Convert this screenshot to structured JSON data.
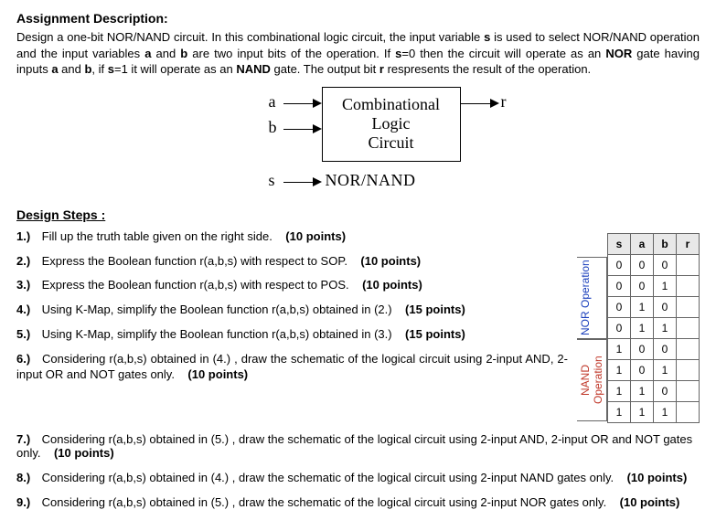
{
  "title": "Assignment Description:",
  "description_parts": {
    "p1": "Design a one-bit NOR/NAND circuit. In this combinational logic circuit, the input variable ",
    "s": "s",
    "p2": " is used to select NOR/NAND operation and the input variables ",
    "a": "a",
    "p3": " and ",
    "b": "b",
    "p4": " are two input bits of the operation. If ",
    "s0": "s",
    "p5": "=0 then the circuit will operate as an ",
    "nor": "NOR",
    "p6": " gate having inputs ",
    "a2": "a",
    "p7": " and ",
    "b2": "b",
    "p8": ", if ",
    "s1": "s",
    "p9": "=1 it will operate as an ",
    "nand": "NAND",
    "p10": " gate. The output bit ",
    "r": "r",
    "p11": " respresents the result of the operation."
  },
  "diagram": {
    "a": "a",
    "b": "b",
    "s": "s",
    "r": "r",
    "box_l1": "Combinational",
    "box_l2": "Logic",
    "box_l3": "Circuit",
    "nor_nand": "NOR/NAND"
  },
  "design_steps_title": "Design Steps :",
  "steps": [
    {
      "n": "1.)",
      "t": "Fill up the truth table given on the right side.",
      "p": "(10 points)"
    },
    {
      "n": "2.)",
      "t": "Express the Boolean function r(a,b,s) with respect to SOP.",
      "p": "(10 points)"
    },
    {
      "n": "3.)",
      "t": "Express the Boolean function r(a,b,s) with respect to POS.",
      "p": "(10 points)"
    },
    {
      "n": "4.)",
      "t": "Using K-Map, simplify the Boolean function r(a,b,s) obtained in (2.)",
      "p": "(15 points)"
    },
    {
      "n": "5.)",
      "t": "Using K-Map, simplify the Boolean function r(a,b,s) obtained in (3.)",
      "p": "(15 points)"
    },
    {
      "n": "6.)",
      "t": "Considering r(a,b,s) obtained in (4.) , draw the schematic of the logical circuit using 2-input AND, 2-input OR and NOT gates only.",
      "p": "(10 points)"
    },
    {
      "n": "7.)",
      "t": "Considering r(a,b,s) obtained in (5.) , draw the schematic of the logical circuit using 2-input AND, 2-input OR and NOT gates only.",
      "p": "(10 points)"
    },
    {
      "n": "8.)",
      "t": "Considering r(a,b,s) obtained in (4.) , draw the schematic of the logical circuit using 2-input NAND gates only.",
      "p": "(10 points)"
    },
    {
      "n": "9.)",
      "t": "Considering r(a,b,s) obtained in (5.) , draw the schematic of the logical circuit using 2-input NOR gates only.",
      "p": "(10 points)"
    }
  ],
  "table": {
    "headers": [
      "s",
      "a",
      "b",
      "r"
    ],
    "nor_label": "NOR Operation",
    "nand_label": "NAND Operation",
    "rows": [
      [
        "0",
        "0",
        "0",
        ""
      ],
      [
        "0",
        "0",
        "1",
        ""
      ],
      [
        "0",
        "1",
        "0",
        ""
      ],
      [
        "0",
        "1",
        "1",
        ""
      ],
      [
        "1",
        "0",
        "0",
        ""
      ],
      [
        "1",
        "0",
        "1",
        ""
      ],
      [
        "1",
        "1",
        "0",
        ""
      ],
      [
        "1",
        "1",
        "1",
        ""
      ]
    ]
  }
}
